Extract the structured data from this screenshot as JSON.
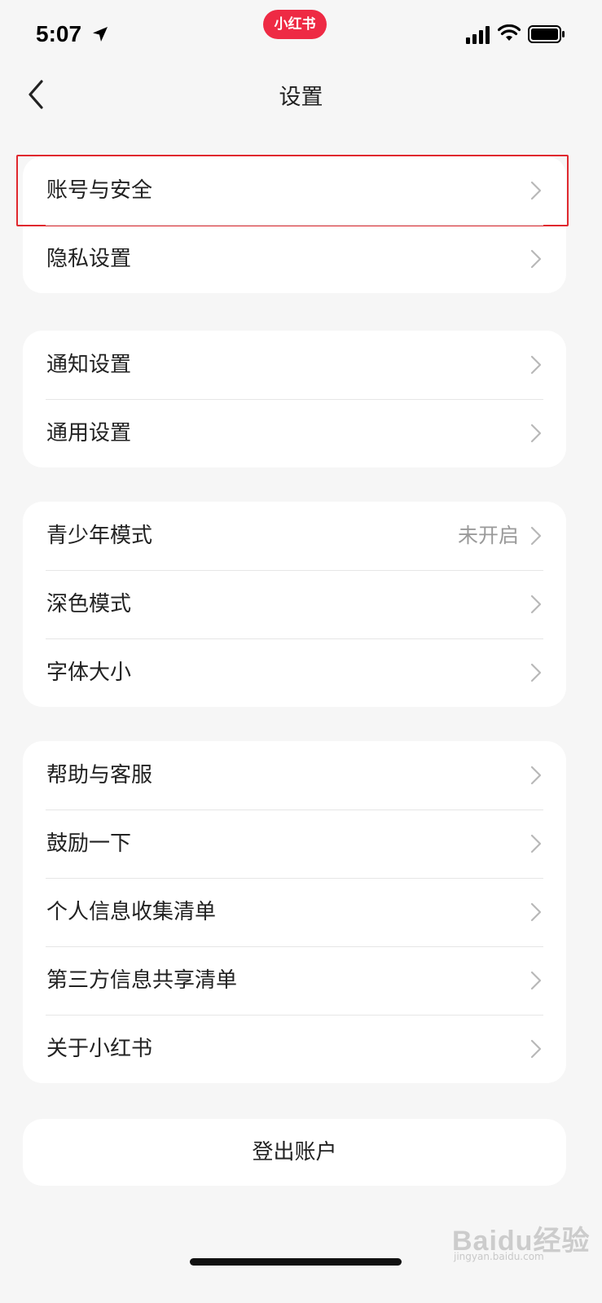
{
  "status_bar": {
    "time": "5:07",
    "app_badge": "小红书",
    "icons": [
      "location-arrow-icon",
      "signal-icon",
      "wifi-icon",
      "battery-icon"
    ]
  },
  "nav": {
    "title": "设置",
    "back_icon": "chevron-left-icon"
  },
  "groups": [
    {
      "items": [
        {
          "label": "账号与安全",
          "highlighted": true
        },
        {
          "label": "隐私设置"
        }
      ]
    },
    {
      "items": [
        {
          "label": "通知设置"
        },
        {
          "label": "通用设置"
        }
      ]
    },
    {
      "items": [
        {
          "label": "青少年模式",
          "value": "未开启"
        },
        {
          "label": "深色模式"
        },
        {
          "label": "字体大小"
        }
      ]
    },
    {
      "items": [
        {
          "label": "帮助与客服"
        },
        {
          "label": "鼓励一下"
        },
        {
          "label": "个人信息收集清单"
        },
        {
          "label": "第三方信息共享清单"
        },
        {
          "label": "关于小红书"
        }
      ]
    }
  ],
  "logout_label": "登出账户",
  "watermark": {
    "text": "Baidu经验",
    "sub": "jingyan.baidu.com"
  },
  "colors": {
    "brand": "#ee2a44",
    "highlight_border": "#e0282e",
    "background": "#f6f6f6"
  }
}
